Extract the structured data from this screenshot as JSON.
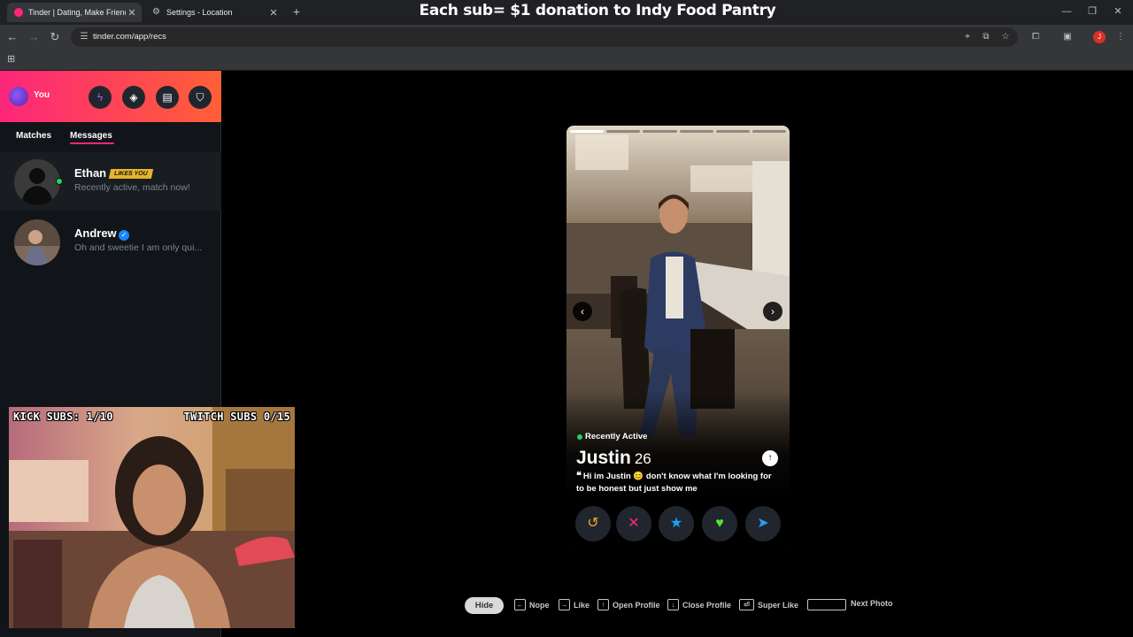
{
  "browser": {
    "tabs": [
      {
        "title": "Tinder | Dating, Make Friends &",
        "active": true,
        "favicon_color": "#fd267a"
      },
      {
        "title": "Settings - Location",
        "active": false,
        "favicon": "gear-icon"
      }
    ],
    "url": "tinder.com/app/recs",
    "profile_initial": "J"
  },
  "banner": "Each sub= $1 donation to Indy Food Pantry",
  "sidebar": {
    "you_label": "You",
    "header_buttons": [
      "boost-icon",
      "explore-icon",
      "briefcase-icon",
      "shield-icon"
    ],
    "tabs": [
      {
        "label": "Matches",
        "active": false
      },
      {
        "label": "Messages",
        "active": true
      }
    ],
    "conversations": [
      {
        "name": "Ethan",
        "badge": "LIKES YOU",
        "snippet": "Recently active, match now!",
        "online": true
      },
      {
        "name": "Andrew",
        "verified": true,
        "snippet": "Oh and sweetie I am only qui..."
      }
    ]
  },
  "stream_overlay": {
    "kick_subs": "KICK SUBS: 1/10",
    "twitch_subs": "TWITCH SUBS 0/15"
  },
  "card": {
    "photo_count": 6,
    "current_photo": 1,
    "status": "Recently Active",
    "name": "Justin",
    "age": "26",
    "bio": "Hi im Justin 😊 don't know what I'm looking for to be honest but just show me",
    "actions": [
      {
        "name": "rewind-button",
        "glyph": "↺",
        "color": "#f5a623"
      },
      {
        "name": "nope-button",
        "glyph": "✕",
        "color": "#fd267a"
      },
      {
        "name": "super-like-button",
        "glyph": "★",
        "color": "#1da1f2"
      },
      {
        "name": "like-button",
        "glyph": "♥",
        "color": "#4ee832"
      },
      {
        "name": "boost-button",
        "glyph": "➤",
        "color": "#2b9df4"
      }
    ]
  },
  "hints": {
    "hide": "Hide",
    "items": [
      {
        "key": "←",
        "label": "Nope"
      },
      {
        "key": "→",
        "label": "Like"
      },
      {
        "key": "↑",
        "label": "Open Profile"
      },
      {
        "key": "↓",
        "label": "Close Profile"
      },
      {
        "key": "⏎",
        "label": "Super Like"
      },
      {
        "key": "",
        "label": "Next Photo"
      }
    ]
  }
}
